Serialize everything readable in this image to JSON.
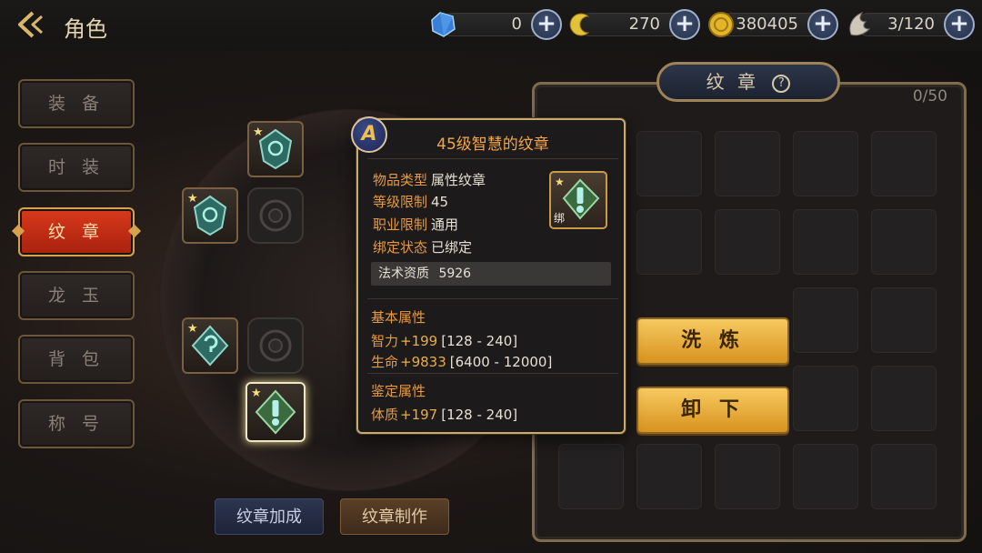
{
  "header": {
    "title": "角色",
    "resources": [
      {
        "icon": "blue-gem-icon",
        "value": "0"
      },
      {
        "icon": "gold-crescent-icon",
        "value": "270"
      },
      {
        "icon": "gold-coin-icon",
        "value": "380405"
      },
      {
        "icon": "wing-icon",
        "value": "3/120"
      }
    ]
  },
  "menu": {
    "items": [
      "装 备",
      "时 装",
      "纹 章",
      "龙 玉",
      "背 包",
      "称 号"
    ],
    "active": "纹 章"
  },
  "bottom_buttons": {
    "emblem_bonus": "纹章加成",
    "emblem_craft": "纹章制作"
  },
  "panel": {
    "title": "纹 章",
    "count": "0/50"
  },
  "actions": {
    "refine": "洗 炼",
    "unequip": "卸 下"
  },
  "tooltip": {
    "grade": "A",
    "title": "45级智慧的纹章",
    "rows": [
      {
        "key": "物品类型",
        "value": "属性纹章"
      },
      {
        "key": "等级限制",
        "value": "45"
      },
      {
        "key": "职业限制",
        "value": "通用"
      },
      {
        "key": "绑定状态",
        "value": "已绑定"
      }
    ],
    "bound_label": "绑",
    "aptitude_label": "法术资质",
    "aptitude_value": "5926",
    "basic_title": "基本属性",
    "basic_stats": [
      {
        "key": "智力",
        "plus": "+199",
        "range": "[128 - 240]"
      },
      {
        "key": "生命",
        "plus": "+9833",
        "range": "[6400 - 12000]"
      }
    ],
    "identify_title": "鉴定属性",
    "identify_stats": [
      {
        "key": "体质",
        "plus": "+197",
        "range": "[128 - 240]"
      }
    ]
  },
  "colors": {
    "accent_gold": "#d6a24c",
    "active_tab": "#c42c14",
    "tooltip_key": "#e89a42"
  }
}
